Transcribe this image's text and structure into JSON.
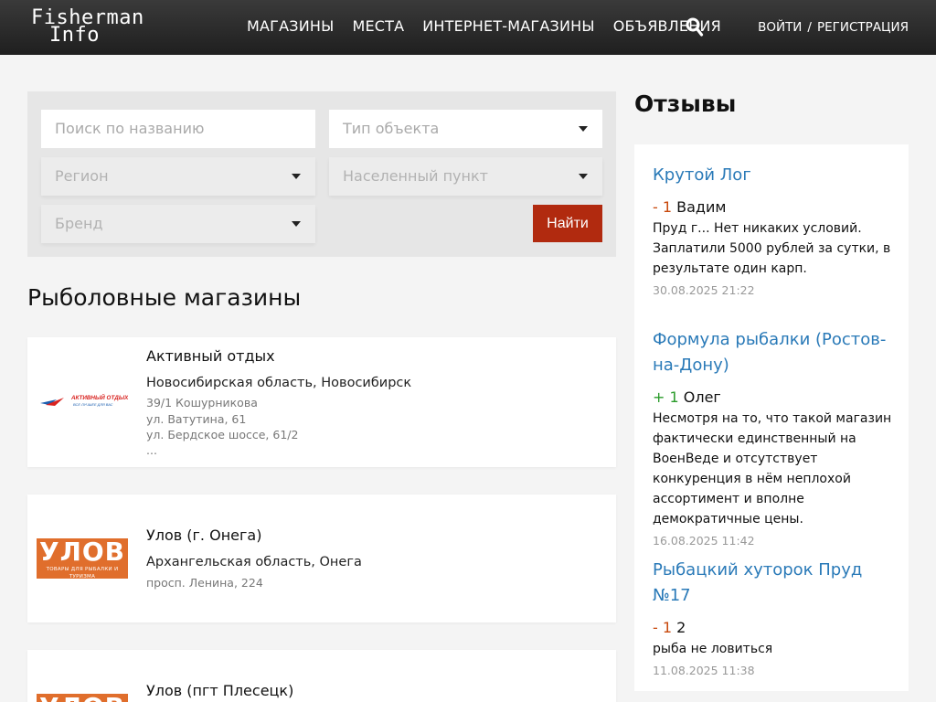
{
  "header": {
    "logo_line1": "Fisherman",
    "logo_line2": "Info",
    "nav": [
      "МАГАЗИНЫ",
      "МЕСТА",
      "ИНТЕРНЕТ-МАГАЗИНЫ",
      "ОБЪЯВЛЕНИЯ"
    ],
    "login": "ВОЙТИ",
    "separator": "/",
    "register": "РЕГИСТРАЦИЯ"
  },
  "filters": {
    "name_placeholder": "Поиск по названию",
    "type": "Тип объекта",
    "region": "Регион",
    "city": "Населенный пункт",
    "brand": "Бренд",
    "submit": "Найти"
  },
  "shops": {
    "title": "Рыболовные магазины",
    "items": [
      {
        "name": "Активный отдых",
        "region": "Новосибирская область, Новосибирск",
        "addresses": [
          "39/1 Кошурникова",
          "ул. Ватутина, 61",
          "ул. Бердское шоссе, 61/2",
          "..."
        ],
        "logo_text": "АКТИВНЫЙ ОТДЫХ",
        "logo_sub": "ВСЕ ЛУЧШЕЕ ДЛЯ ВАС"
      },
      {
        "name": "Улов (г. Онега)",
        "region": "Архангельская область, Онега",
        "addresses": [
          "просп. Ленина, 224"
        ],
        "logo_text": "УЛОВ",
        "logo_sub": "ТОВАРЫ ДЛЯ РЫБАЛКИ И ТУРИЗМА"
      },
      {
        "name": "Улов (пгт Плесецк)",
        "logo_text": "УЛОВ"
      }
    ]
  },
  "reviews": {
    "title": "Отзывы",
    "items": [
      {
        "place": "Крутой Лог",
        "score": "- 1",
        "author": "Вадим",
        "text": "Пруд г... Нет никаких условий. Заплатили 5000 рублей за сутки, в результате один карп.",
        "date": "30.08.2025 21:22"
      },
      {
        "place": "Формула рыбалки (Ростов-на-Дону)",
        "score": "+ 1",
        "author": "Олег",
        "text": "Несмотря на то, что такой магазин фактически единственный на ВоенВеде и отсутствует конкуренция в нём неплохой ассортимент и вполне демократичные цены.",
        "date": "16.08.2025 11:42"
      },
      {
        "place": "Рыбацкий хуторок Пруд №17",
        "score": "- 1",
        "author": "2",
        "text": "рыба не ловиться",
        "date": "11.08.2025 11:38"
      }
    ]
  },
  "colors": {
    "header_bg": "#2a2a2a",
    "accent_button": "#b12a0f",
    "link": "#2a7ab8",
    "negative": "#c8490c",
    "positive": "#2a9b2a",
    "ulov_orange": "#e06e2c"
  },
  "icons": {
    "search": "search-icon",
    "dropdown": "caret-down-icon"
  }
}
